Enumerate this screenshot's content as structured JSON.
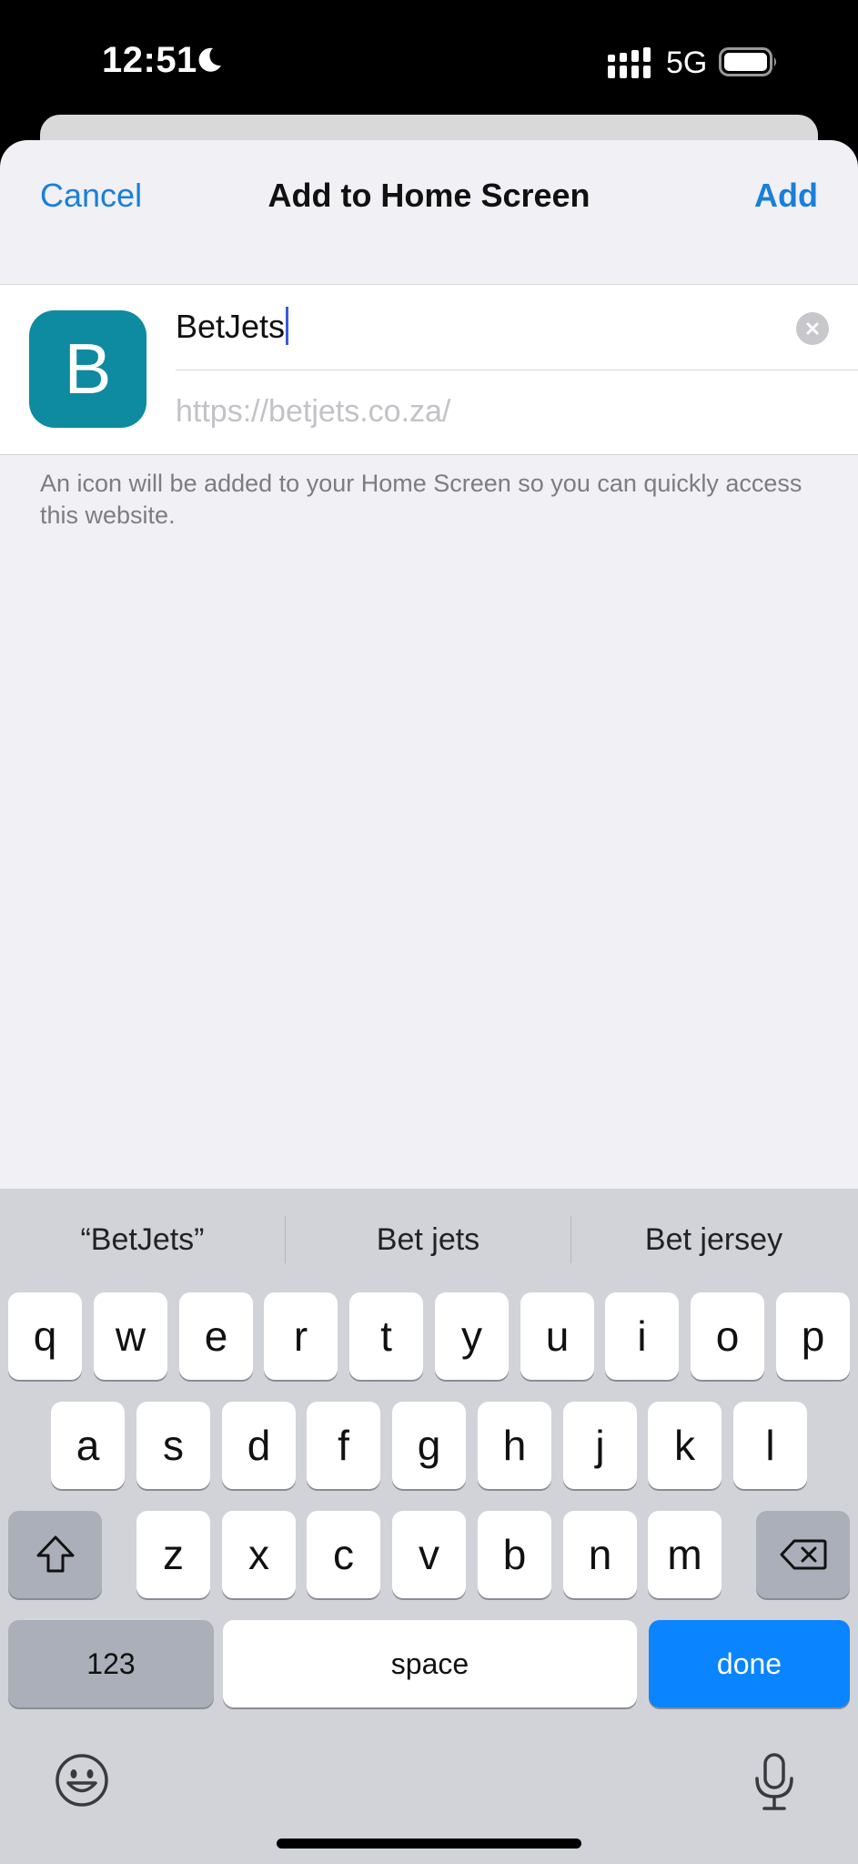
{
  "status_bar": {
    "time": "12:51",
    "network": "5G"
  },
  "sheet": {
    "cancel_label": "Cancel",
    "title": "Add to Home Screen",
    "add_label": "Add",
    "icon_letter": "B",
    "name_value": "BetJets",
    "url": "https://betjets.co.za/",
    "hint": "An icon will be added to your Home Screen so you can quickly access this website."
  },
  "keyboard": {
    "suggestions": [
      "“BetJets”",
      "Bet jets",
      "Bet jersey"
    ],
    "row1": [
      "q",
      "w",
      "e",
      "r",
      "t",
      "y",
      "u",
      "i",
      "o",
      "p"
    ],
    "row2": [
      "a",
      "s",
      "d",
      "f",
      "g",
      "h",
      "j",
      "k",
      "l"
    ],
    "row3": [
      "z",
      "x",
      "c",
      "v",
      "b",
      "n",
      "m"
    ],
    "numbers_label": "123",
    "space_label": "space",
    "done_label": "done"
  },
  "colors": {
    "accent": "#1a7fd9",
    "app_icon": "#0e8aa1",
    "done_key": "#0a84ff"
  }
}
